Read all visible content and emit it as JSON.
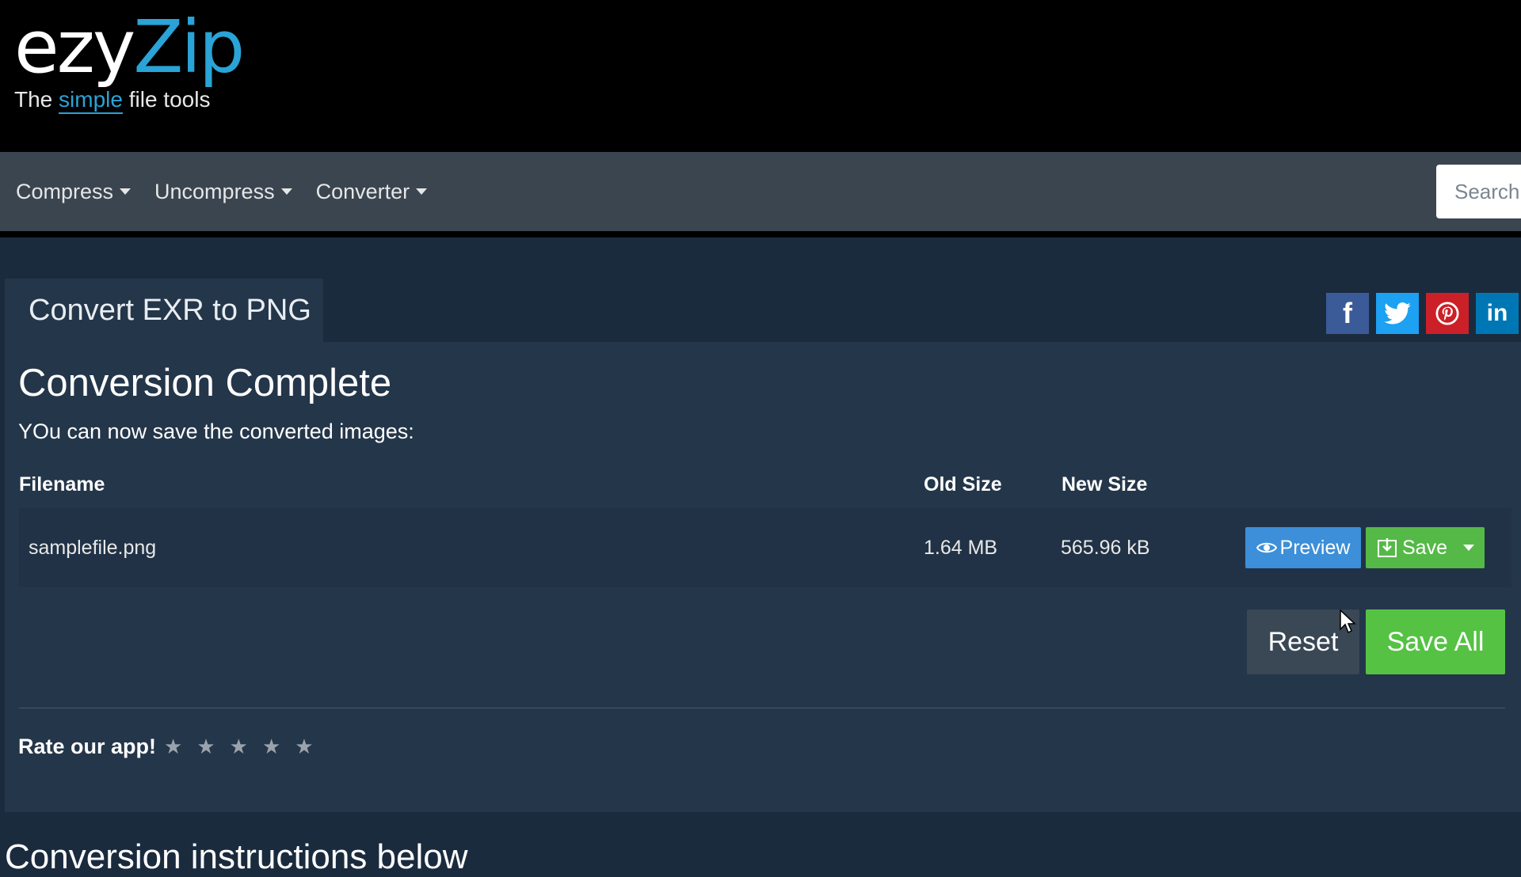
{
  "header": {
    "logo_ezy": "ezy",
    "logo_zip": "Zip",
    "tagline_pre": "The ",
    "tagline_em": "simple",
    "tagline_post": " file tools"
  },
  "nav": {
    "items": [
      {
        "label": "Compress"
      },
      {
        "label": "Uncompress"
      },
      {
        "label": "Converter"
      }
    ],
    "search_placeholder": "Search"
  },
  "tab": {
    "label": "Convert EXR to PNG"
  },
  "social": {
    "icons": [
      "facebook-icon",
      "twitter-icon",
      "pinterest-icon",
      "linkedin-icon"
    ],
    "colors": {
      "facebook": "#3b5b98",
      "twitter": "#1da1f2",
      "pinterest": "#cb2027",
      "linkedin": "#0077b5"
    }
  },
  "result": {
    "title": "Conversion Complete",
    "subtitle": "YOu can now save the converted images:",
    "columns": {
      "filename": "Filename",
      "old_size": "Old Size",
      "new_size": "New Size"
    },
    "rows": [
      {
        "filename": "samplefile.png",
        "old_size": "1.64 MB",
        "new_size": "565.96 kB"
      }
    ],
    "preview_label": "Preview",
    "save_label": "Save",
    "reset_label": "Reset",
    "save_all_label": "Save All"
  },
  "rating": {
    "label": "Rate our app!",
    "stars_total": 5,
    "stars_filled": 0
  },
  "footer": {
    "heading": "Conversion instructions below"
  },
  "colors": {
    "accent_blue": "#2aa3d6",
    "preview_button": "#3c8fd8",
    "save_button": "#55b947",
    "page_background": "#1b2b3e",
    "card_background": "#243649"
  }
}
